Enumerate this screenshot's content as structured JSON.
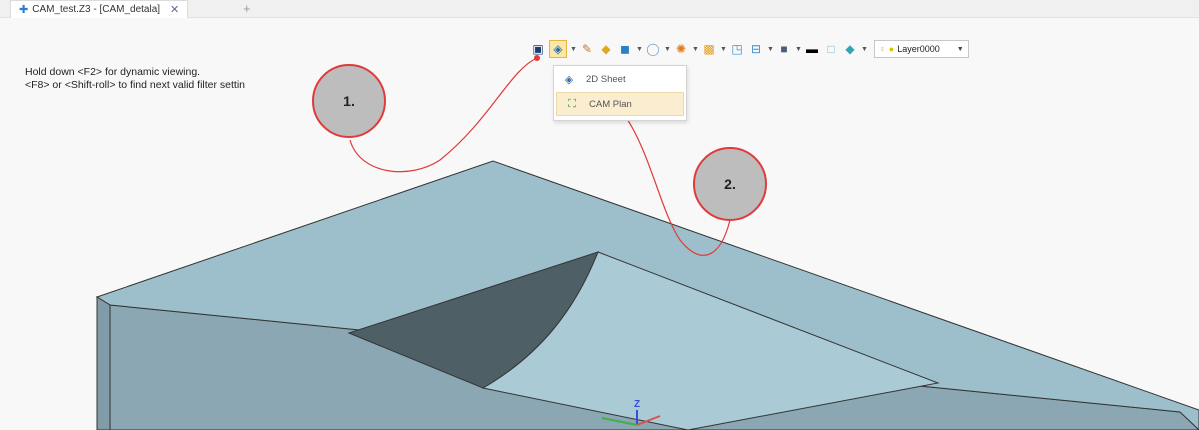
{
  "tab": {
    "title": "CAM_test.Z3 - [CAM_detala]",
    "close": "✕",
    "new_tab": "+"
  },
  "hint": {
    "line1": "Hold down <F2> for dynamic viewing.",
    "line2": "<F8> or <Shift-roll> to find next valid filter settin"
  },
  "toolbar": {
    "layer_name": "Layer0000",
    "icons": [
      "view-icon",
      "sheet-view-icon",
      "pencil-icon",
      "solid-icon",
      "cube-icon",
      "sphere-icon",
      "color-icon",
      "texture-icon",
      "frame-icon",
      "section-icon",
      "material-icon",
      "line-icon",
      "fill-icon",
      "shade-icon",
      "bulb-icon",
      "layer-dot-icon"
    ]
  },
  "menu": {
    "items": [
      {
        "label": "2D Sheet",
        "icon": "sheet-icon"
      },
      {
        "label": "CAM Plan",
        "icon": "cam-plan-icon"
      }
    ]
  },
  "callouts": {
    "one": "1.",
    "two": "2."
  },
  "axis": {
    "z": "Z"
  },
  "colors": {
    "part_top": "#9dbfcc",
    "part_side": "#8aa7b3",
    "pocket_wall": "#4e5f66",
    "pocket_floor": "#a9c6d2",
    "annotation": "#e03a3a"
  }
}
